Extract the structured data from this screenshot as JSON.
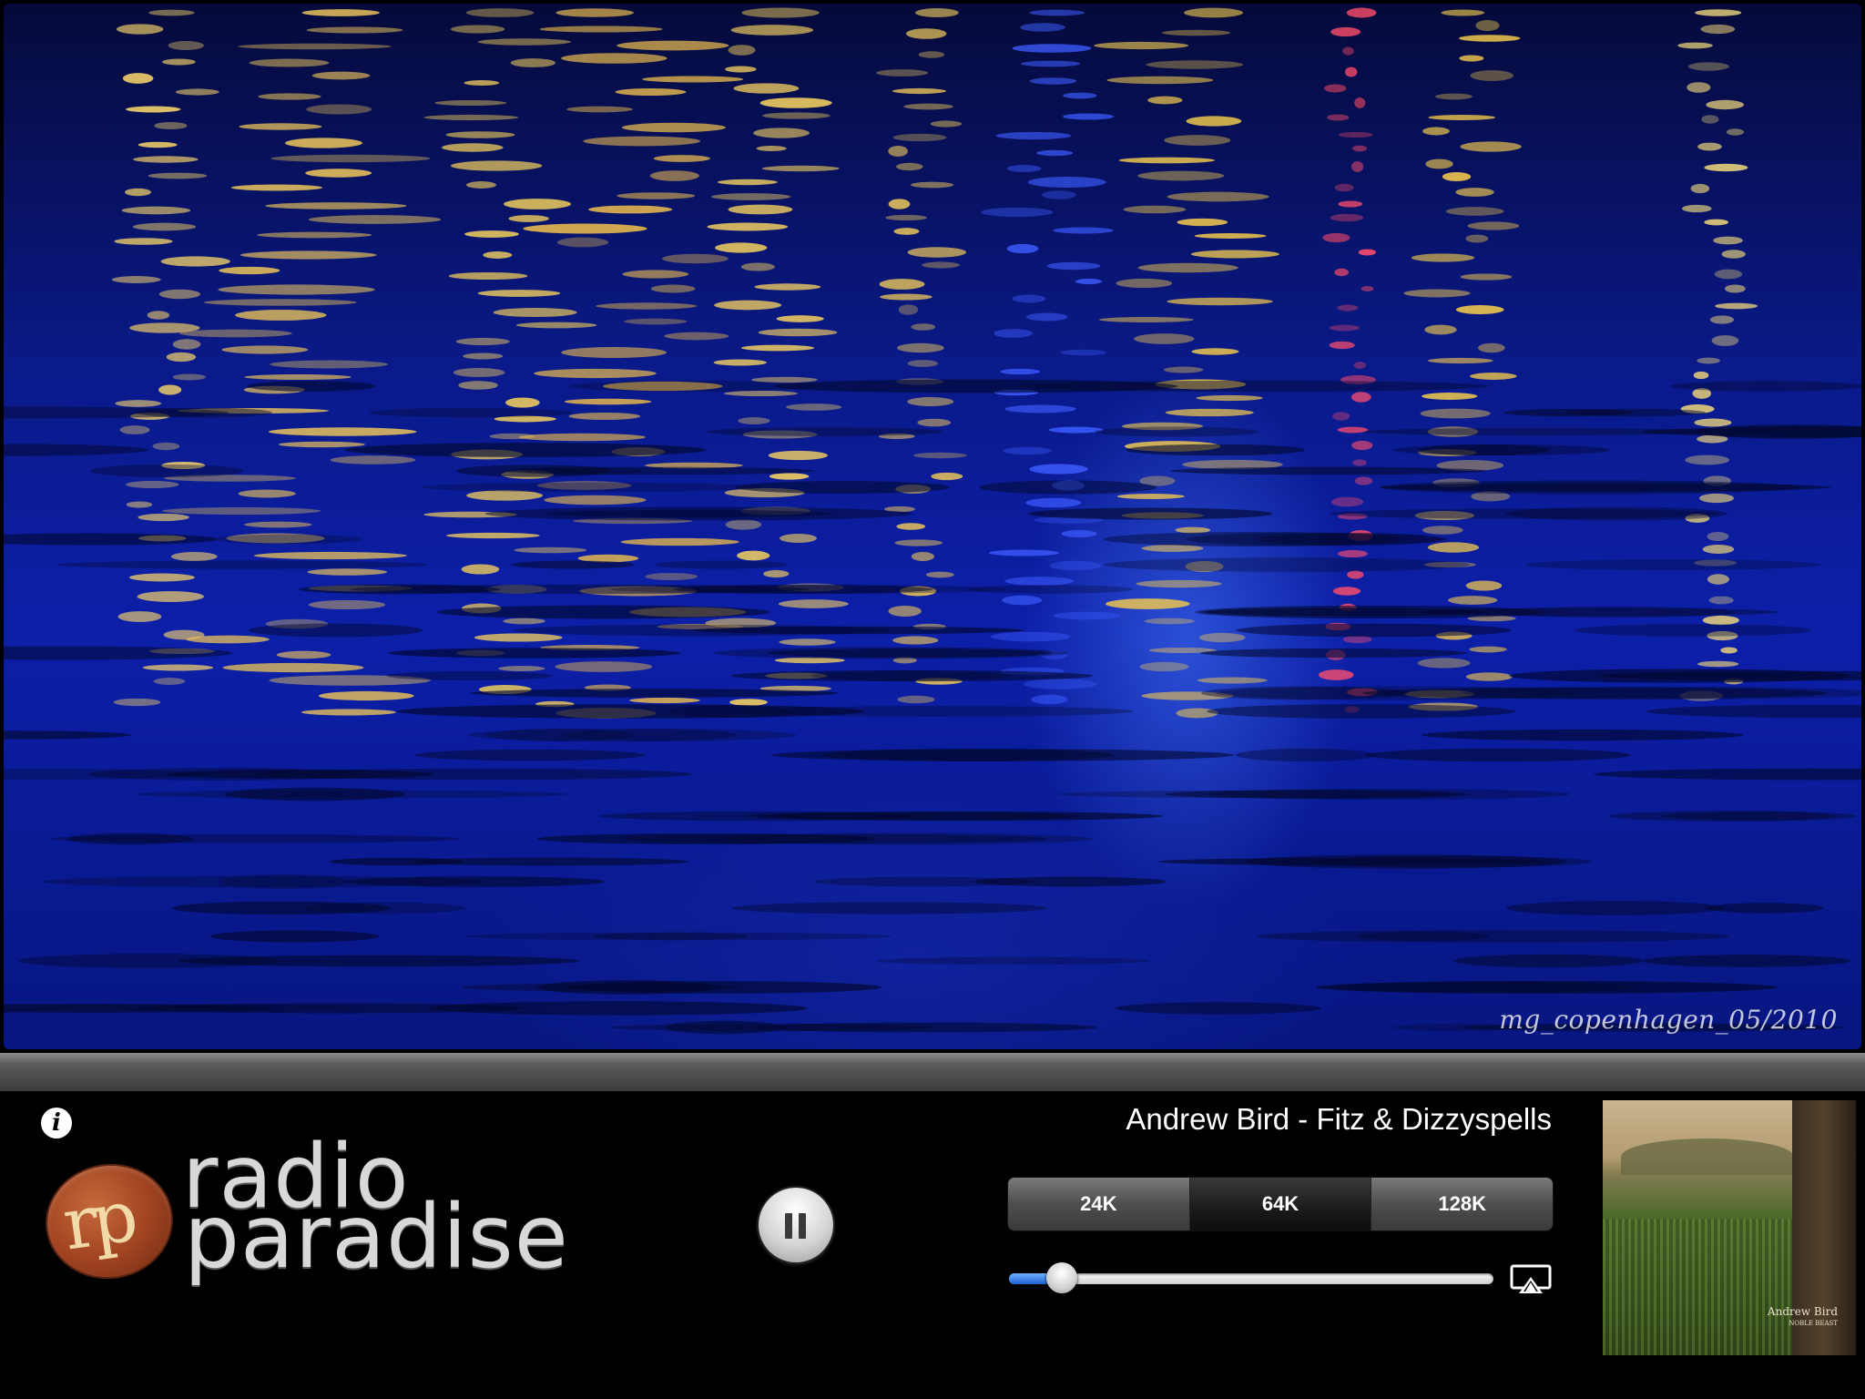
{
  "photo": {
    "credit": "mg_copenhagen_05/2010"
  },
  "header": {
    "info_icon": "info-icon",
    "info_glyph": "i"
  },
  "logo": {
    "initials": "rp",
    "line1": "radio",
    "line2": "paradise"
  },
  "player": {
    "state": "playing",
    "pause_icon": "pause-icon",
    "track_title": "Andrew Bird - Fitz & Dizzyspells",
    "bitrates": [
      "24K",
      "64K",
      "128K"
    ],
    "selected_bitrate": "64K",
    "volume": 0.09,
    "airplay_icon": "airplay-icon"
  },
  "album": {
    "artist_caption": "Andrew Bird",
    "album_caption": "NOBLE BEAST"
  },
  "colors": {
    "water_blue": "#0c1fa8",
    "volume_fill": "#1f63d6"
  }
}
